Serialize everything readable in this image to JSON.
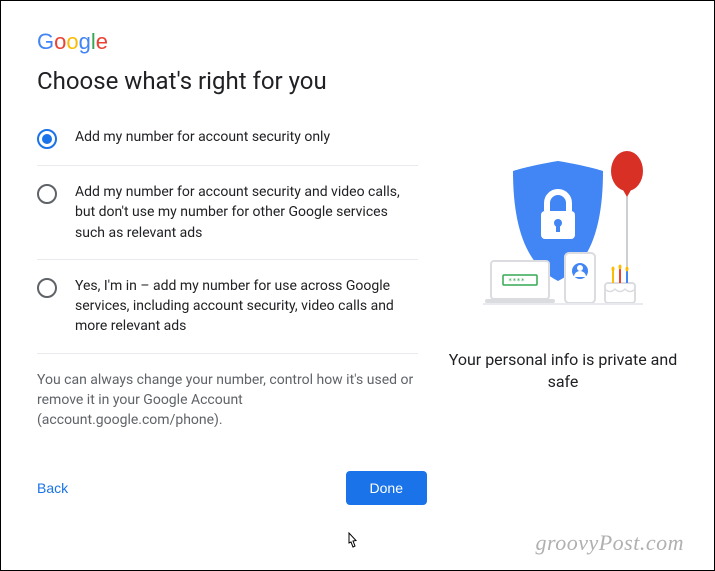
{
  "logo": {
    "text": "Google"
  },
  "heading": "Choose what's right for you",
  "options": [
    {
      "label": "Add my number for account security only",
      "selected": true
    },
    {
      "label": "Add my number for account security and video calls, but don't use my number for other Google services such as relevant ads",
      "selected": false
    },
    {
      "label": "Yes, I'm in – add my number for use across Google services, including account security, video calls and more relevant ads",
      "selected": false
    }
  ],
  "footnote": "You can always change your number, control how it's used or remove it in your Google Account (account.google.com/phone).",
  "actions": {
    "back": "Back",
    "done": "Done"
  },
  "illustration": {
    "caption": "Your personal info is private and safe"
  },
  "watermark": "groovyPost.com"
}
